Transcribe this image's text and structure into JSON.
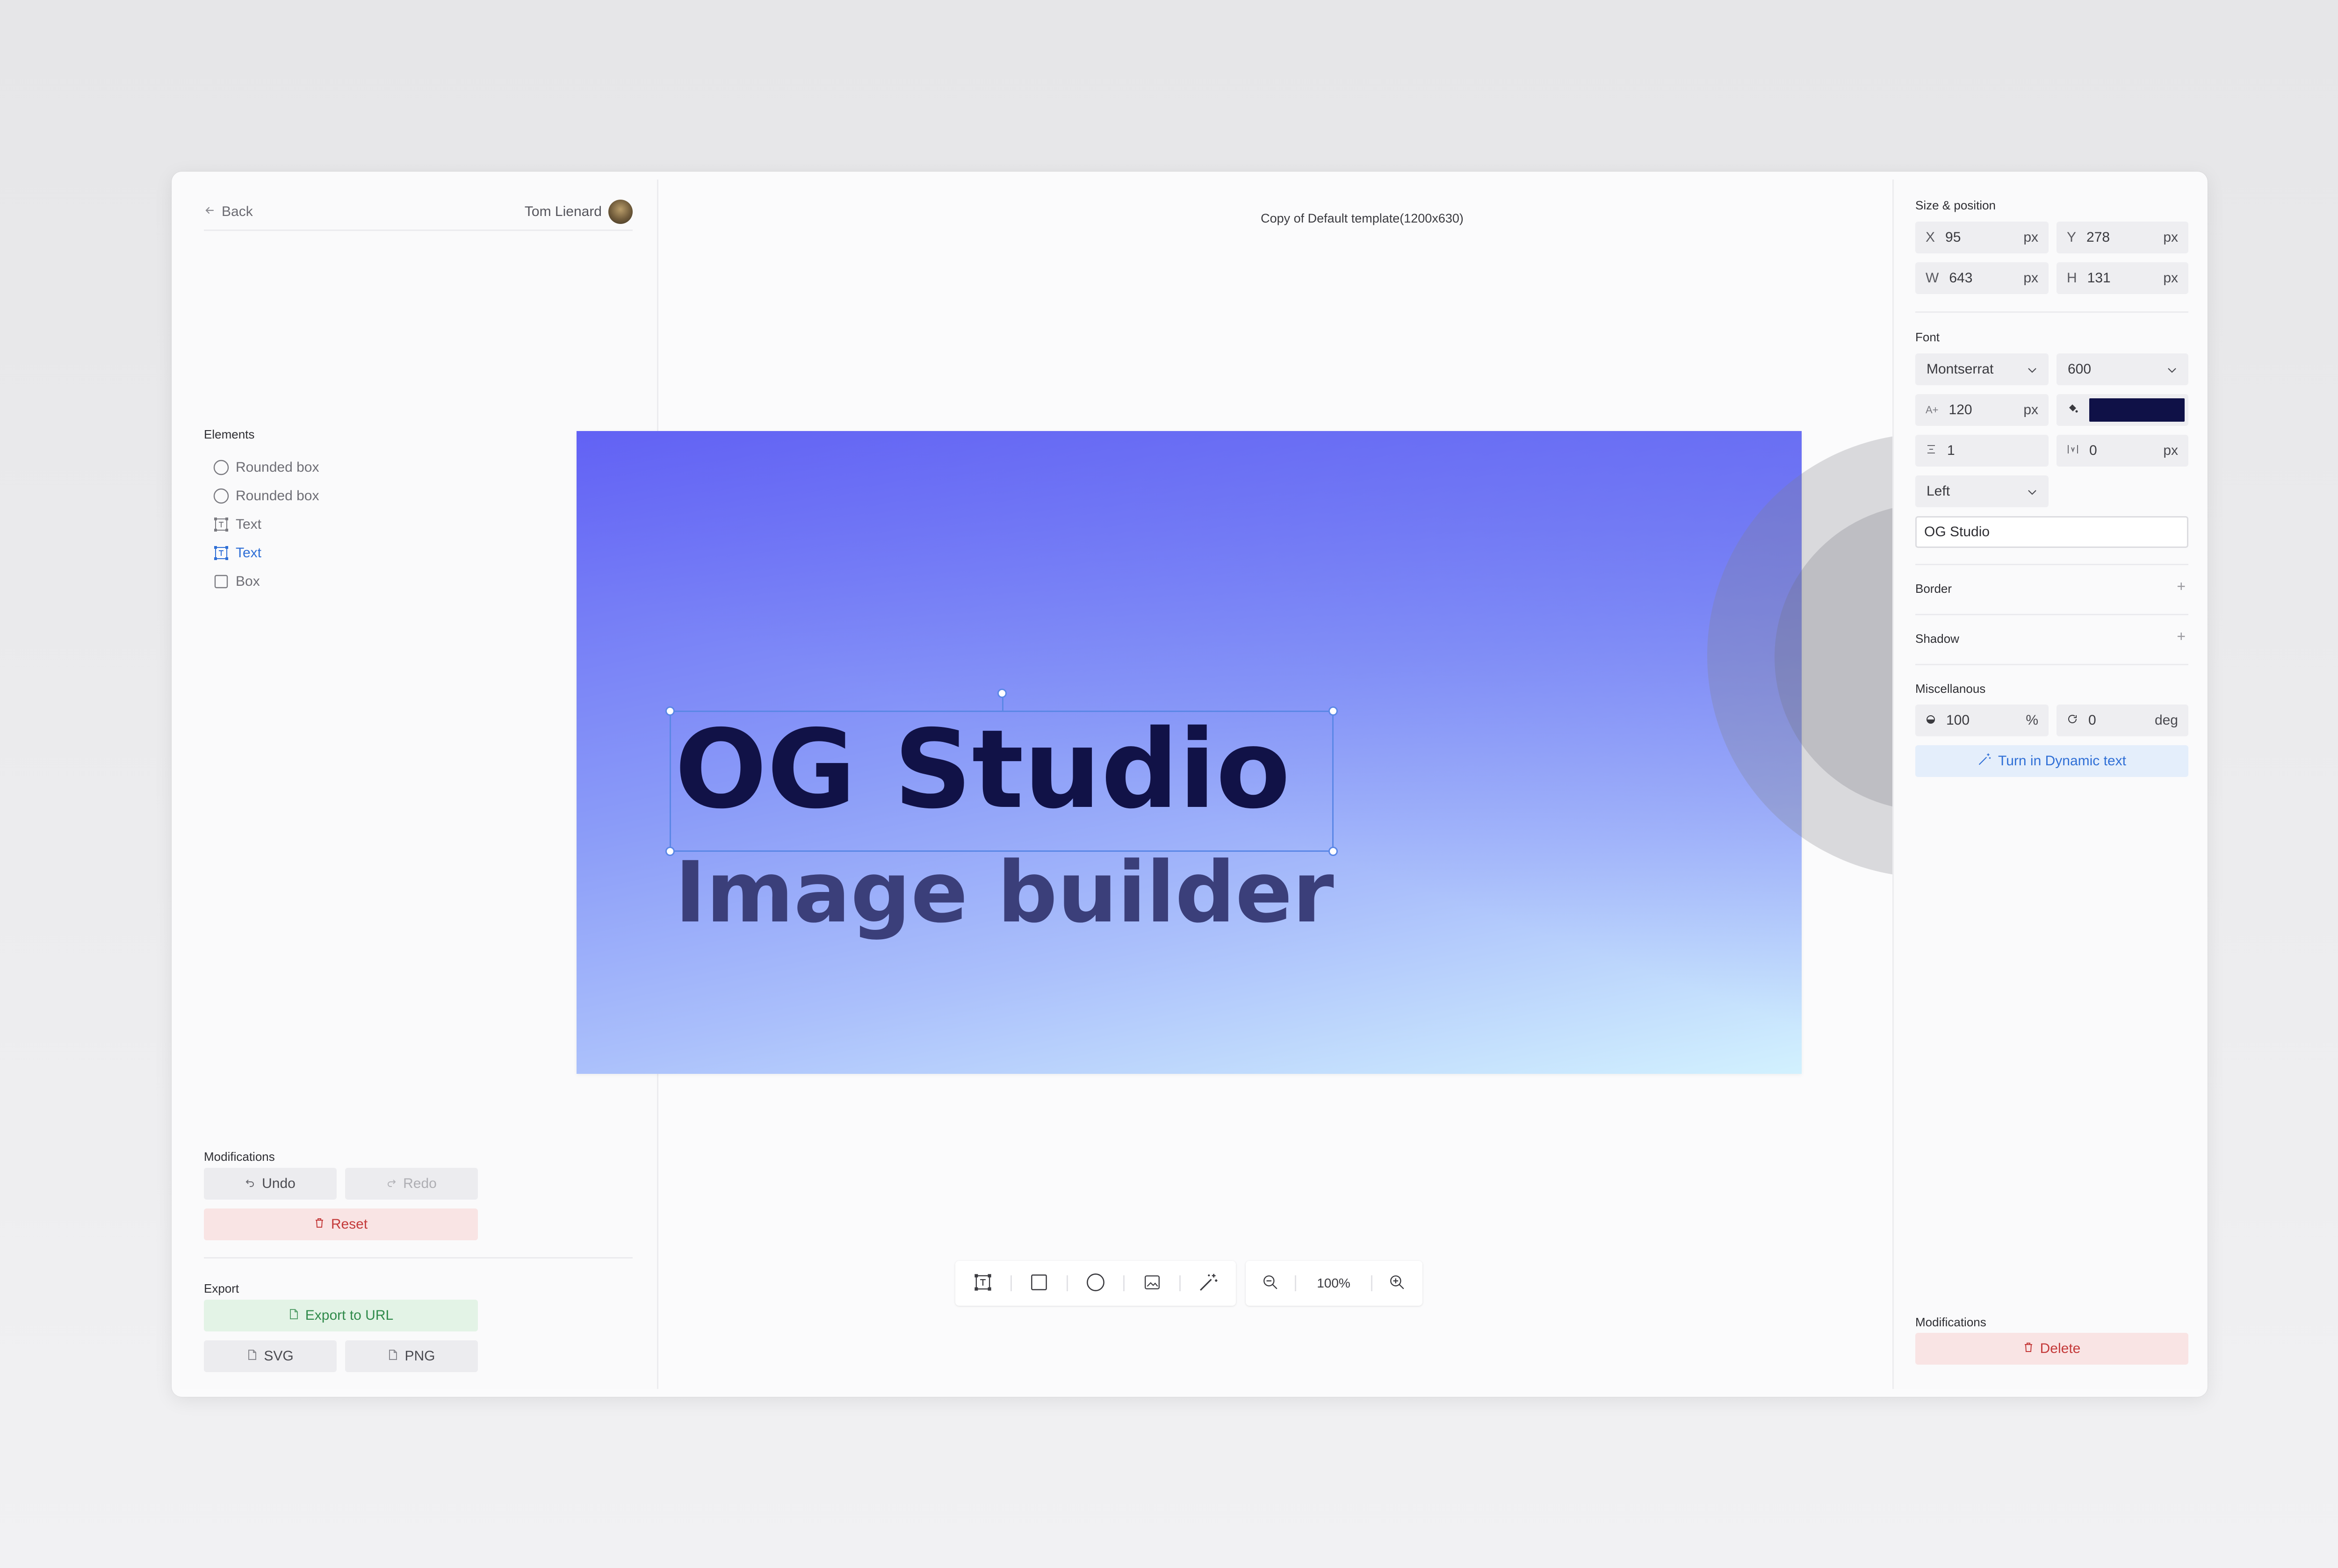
{
  "left_panel": {
    "back_label": "Back",
    "user_name": "Tom Lienard",
    "elements_title": "Elements",
    "elements": [
      {
        "label": "Rounded box",
        "icon": "circle-icon"
      },
      {
        "label": "Rounded box",
        "icon": "circle-icon"
      },
      {
        "label": "Text",
        "icon": "text-frame-icon"
      },
      {
        "label": "Text",
        "icon": "text-frame-icon",
        "active": true
      },
      {
        "label": "Box",
        "icon": "square-icon"
      }
    ],
    "modifications_title": "Modifications",
    "undo_label": "Undo",
    "redo_label": "Redo",
    "reset_label": "Reset",
    "export_title": "Export",
    "export_url_label": "Export to URL",
    "svg_label": "SVG",
    "png_label": "PNG"
  },
  "canvas": {
    "document_title": "Copy of Default template(1200x630)",
    "title_text": "OG Studio",
    "subtitle_text": "Image builder",
    "zoom_label": "100%"
  },
  "right_panel": {
    "size_title": "Size & position",
    "x": {
      "label": "X",
      "value": "95",
      "unit": "px"
    },
    "y": {
      "label": "Y",
      "value": "278",
      "unit": "px"
    },
    "w": {
      "label": "W",
      "value": "643",
      "unit": "px"
    },
    "h": {
      "label": "H",
      "value": "131",
      "unit": "px"
    },
    "font_title": "Font",
    "font_family": "Montserrat",
    "font_weight": "600",
    "font_size": {
      "value": "120",
      "unit": "px"
    },
    "font_color": "#0f1147",
    "line_height": {
      "value": "1"
    },
    "letter_spacing": {
      "value": "0",
      "unit": "px"
    },
    "align": "Left",
    "text_content": "OG Studio",
    "border_title": "Border",
    "shadow_title": "Shadow",
    "misc_title": "Miscellanous",
    "opacity": {
      "value": "100",
      "unit": "%"
    },
    "rotation": {
      "value": "0",
      "unit": "deg"
    },
    "dynamic_label": "Turn in Dynamic text",
    "modifications_title": "Modifications",
    "delete_label": "Delete"
  }
}
